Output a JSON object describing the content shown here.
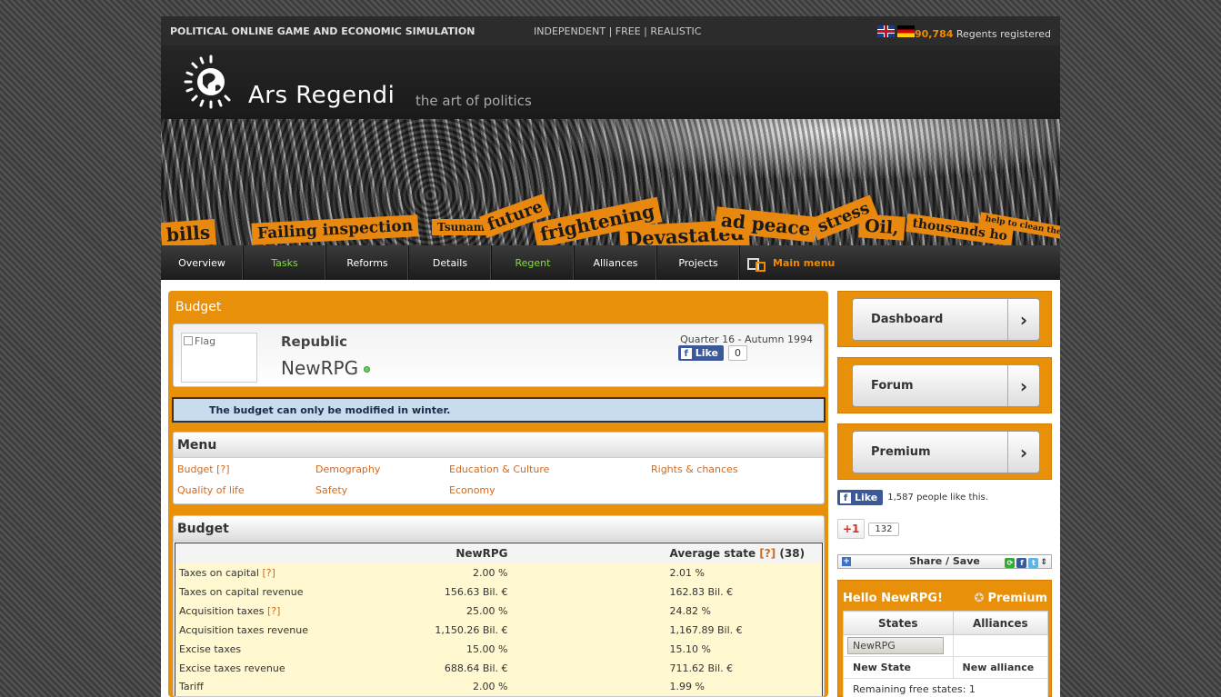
{
  "topbar": {
    "tagline": "POLITICAL ONLINE GAME AND ECONOMIC SIMULATION",
    "slogan_1": "INDEPENDENT",
    "slogan_2": "FREE",
    "slogan_3": "REALISTIC",
    "regents_count": "90,784",
    "regents_label": "Regents registered"
  },
  "logo": {
    "brand": "Ars Regendi",
    "sub": "the art of politics"
  },
  "banner": {
    "headlines": [
      "bills",
      "Failing inspection",
      "Tsunami",
      "future",
      "frightening",
      "Devastated",
      "ad peace",
      "stress",
      "Oil,",
      "thousands ho",
      "help to clean the air"
    ]
  },
  "nav": {
    "items": [
      "Overview",
      "Tasks",
      "Reforms",
      "Details",
      "Regent",
      "Alliances",
      "Projects"
    ],
    "main_menu": "Main menu"
  },
  "main": {
    "title": "Budget",
    "flag_alt": "Flag",
    "state_type": "Republic",
    "state_name": "NewRPG",
    "quarter": "Quarter 16 - Autumn 1994",
    "like_label": "Like",
    "like_count": "0",
    "notice": "The budget can only be modified in winter."
  },
  "menu": {
    "title": "Menu",
    "links": [
      "Budget",
      "Demography",
      "Education & Culture",
      "Rights & chances",
      "Quality of life",
      "Safety",
      "Economy"
    ],
    "help": "[?]"
  },
  "budget": {
    "title": "Budget",
    "col_state": "NewRPG",
    "col_avg": "Average state",
    "col_avg_count": "(38)",
    "help": "[?]",
    "rows": [
      {
        "label": "Taxes on capital",
        "help": "[?]",
        "state": "2.00 %",
        "avg": "2.01 %"
      },
      {
        "label": "Taxes on capital revenue",
        "help": "",
        "state": "156.63 Bil. €",
        "avg": "162.83 Bil. €"
      },
      {
        "label": "Acquisition taxes",
        "help": "[?]",
        "state": "25.00 %",
        "avg": "24.82 %"
      },
      {
        "label": "Acquisition taxes revenue",
        "help": "",
        "state": "1,150.26 Bil. €",
        "avg": "1,167.89 Bil. €"
      },
      {
        "label": "Excise taxes",
        "help": "",
        "state": "15.00 %",
        "avg": "15.10 %"
      },
      {
        "label": "Excise taxes revenue",
        "help": "",
        "state": "688.64 Bil. €",
        "avg": "711.62 Bil. €"
      },
      {
        "label": "Tariff",
        "help": "",
        "state": "2.00 %",
        "avg": "1.99 %"
      }
    ]
  },
  "sidebar": {
    "buttons": [
      "Dashboard",
      "Forum",
      "Premium"
    ],
    "fb_like": "Like",
    "fb_text": "1,587 people like this.",
    "gplus_label": "+1",
    "gplus_count": "132",
    "share_label": "Share / Save",
    "hello": "Hello NewRPG!",
    "premium": "Premium",
    "col_states": "States",
    "col_alliances": "Alliances",
    "state_entry": "NewRPG",
    "new_state": "New State",
    "new_alliance": "New alliance",
    "remaining": "Remaining free states: 1"
  },
  "colors": {
    "accent": "#e8900a",
    "link": "#d2691e",
    "green_nav": "#7fe03a",
    "fb": "#3b5998"
  }
}
